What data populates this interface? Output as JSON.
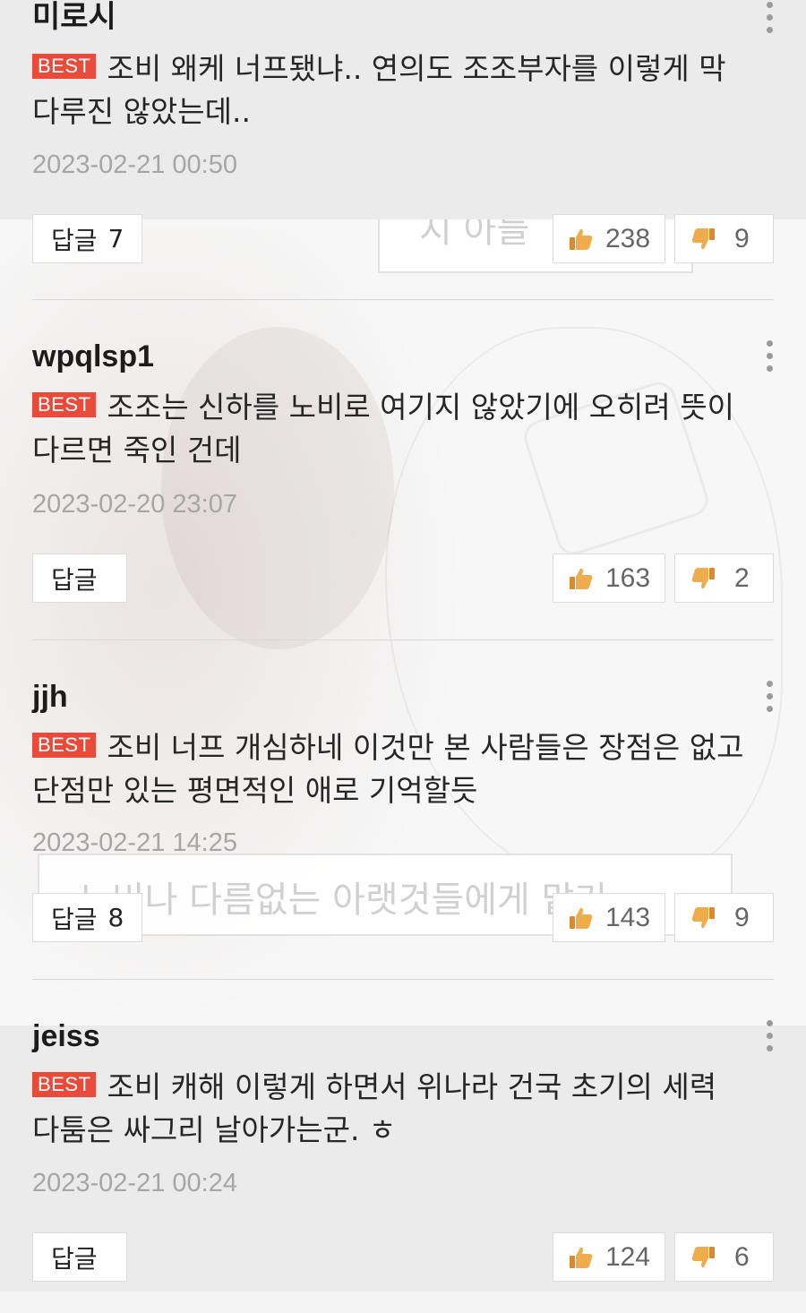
{
  "background_bubbles": {
    "top_text": "지 아들 ",
    "bottom_text": "노비나 다름없는 아랫것들에게 맡기"
  },
  "comments": [
    {
      "author": "미로시",
      "badge": "BEST",
      "text": "조비 왜케 너프됐냐.. 연의도 조조부자를 이렇게 막다루진 않았는데..",
      "timestamp": "2023-02-21 00:50",
      "reply_label": "답글",
      "reply_count": "7",
      "likes": "238",
      "dislikes": "9"
    },
    {
      "author": "wpqlsp1",
      "badge": "BEST",
      "text": "조조는 신하를 노비로 여기지 않았기에 오히려 뜻이 다르면 죽인 건데",
      "timestamp": "2023-02-20 23:07",
      "reply_label": "답글",
      "reply_count": "",
      "likes": "163",
      "dislikes": "2"
    },
    {
      "author": "jjh",
      "badge": "BEST",
      "text": "조비 너프 개심하네 이것만 본 사람들은 장점은 없고 단점만 있는 평면적인 애로 기억할듯",
      "timestamp": "2023-02-21 14:25",
      "reply_label": "답글",
      "reply_count": "8",
      "likes": "143",
      "dislikes": "9"
    },
    {
      "author": "jeiss",
      "badge": "BEST",
      "text": "조비 캐해 이렇게 하면서 위나라 건국 초기의 세력 다툼은 싸그리 날아가는군. ㅎ",
      "timestamp": "2023-02-21 00:24",
      "reply_label": "답글",
      "reply_count": "",
      "likes": "124",
      "dislikes": "6"
    }
  ],
  "colors": {
    "badge": "#ea4a3a",
    "timestamp": "#a6a6a6",
    "thumb_up": "#e8a23a",
    "thumb_down": "#e8a23a"
  },
  "icons": {
    "more": "more-vertical-icon",
    "like": "thumbs-up-icon",
    "dislike": "thumbs-down-icon"
  }
}
